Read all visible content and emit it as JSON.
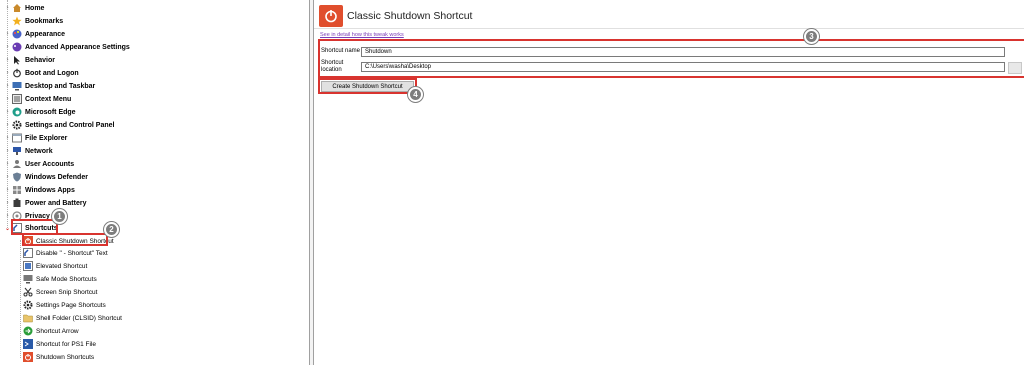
{
  "tree": {
    "items": [
      {
        "label": "Home",
        "icon": "home-icon"
      },
      {
        "label": "Bookmarks",
        "icon": "star-icon"
      },
      {
        "label": "Appearance",
        "icon": "palette-icon"
      },
      {
        "label": "Advanced Appearance Settings",
        "icon": "palette-icon"
      },
      {
        "label": "Behavior",
        "icon": "cursor-icon"
      },
      {
        "label": "Boot and Logon",
        "icon": "power-icon"
      },
      {
        "label": "Desktop and Taskbar",
        "icon": "monitor-icon"
      },
      {
        "label": "Context Menu",
        "icon": "menu-icon"
      },
      {
        "label": "Microsoft Edge",
        "icon": "edge-icon"
      },
      {
        "label": "Settings and Control Panel",
        "icon": "gear-icon"
      },
      {
        "label": "File Explorer",
        "icon": "folder-icon"
      },
      {
        "label": "Network",
        "icon": "network-icon"
      },
      {
        "label": "User Accounts",
        "icon": "users-icon"
      },
      {
        "label": "Windows Defender",
        "icon": "shield-icon"
      },
      {
        "label": "Windows Apps",
        "icon": "apps-icon"
      },
      {
        "label": "Power and Battery",
        "icon": "battery-icon"
      },
      {
        "label": "Privacy",
        "icon": "privacy-icon"
      },
      {
        "label": "Shortcuts",
        "icon": "shortcut-icon"
      }
    ],
    "subitems": [
      {
        "label": "Classic Shutdown Shortcut",
        "icon": "shutdown-icon"
      },
      {
        "label": "Disable \" - Shortcut\" Text",
        "icon": "shortcut-icon"
      },
      {
        "label": "Elevated Shortcut",
        "icon": "admin-icon"
      },
      {
        "label": "Safe Mode Shortcuts",
        "icon": "monitor-icon"
      },
      {
        "label": "Screen Snip Shortcut",
        "icon": "scissors-icon"
      },
      {
        "label": "Settings Page Shortcuts",
        "icon": "gear-icon"
      },
      {
        "label": "Shell Folder (CLSID) Shortcut",
        "icon": "folder-icon"
      },
      {
        "label": "Shortcut Arrow",
        "icon": "arrow-icon"
      },
      {
        "label": "Shortcut for PS1 File",
        "icon": "powershell-icon"
      },
      {
        "label": "Shutdown Shortcuts",
        "icon": "shutdown-icon"
      }
    ]
  },
  "badges": [
    "1",
    "2",
    "3",
    "4"
  ],
  "panel": {
    "title": "Classic Shutdown Shortcut",
    "link": "See in detail how this tweak works",
    "shortcut_name_label": "Shortcut name",
    "shortcut_name_value": "Shutdown",
    "shortcut_location_label_1": "Shortcut",
    "shortcut_location_label_2": "location",
    "shortcut_location_value": "C:\\Users\\washa\\Desktop",
    "create_button": "Create Shutdown Shortcut"
  },
  "colors": {
    "highlight": "#d8342f",
    "badge": "#7d7d7d",
    "accent": "#e04e2d",
    "link": "#7a3db8"
  }
}
